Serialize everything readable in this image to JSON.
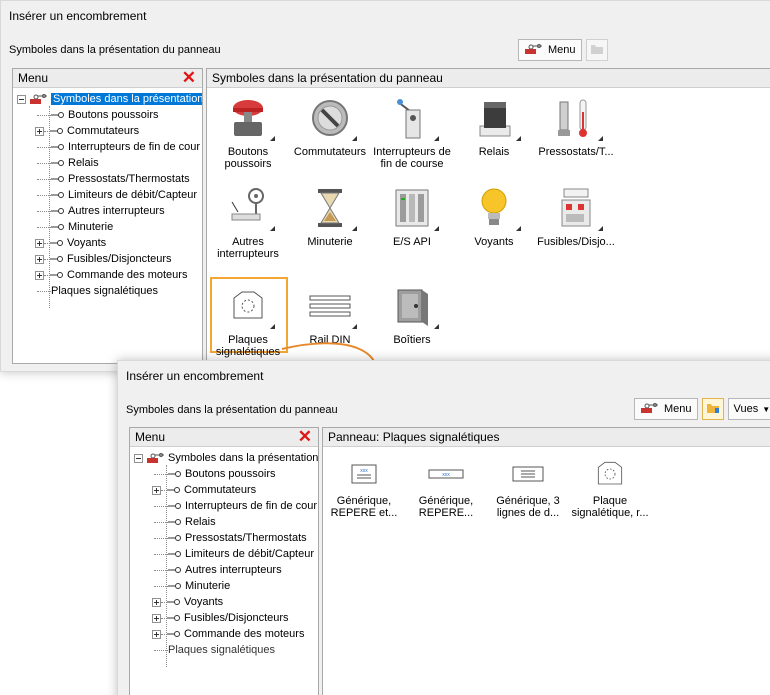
{
  "back_window": {
    "title": "Insérer un encombrement",
    "presentation_label": "Symboles dans la présentation du panneau",
    "menu_button": "Menu",
    "tree_header": "Menu",
    "panel_header": "Symboles dans la présentation du panneau",
    "tree": {
      "root": "Symboles dans la présentation",
      "items": [
        {
          "label": "Boutons poussoirs"
        },
        {
          "label": "Commutateurs"
        },
        {
          "label": "Interrupteurs de fin de cour"
        },
        {
          "label": "Relais"
        },
        {
          "label": "Pressostats/Thermostats"
        },
        {
          "label": "Limiteurs de débit/Capteur"
        },
        {
          "label": "Autres interrupteurs"
        },
        {
          "label": "Minuterie"
        },
        {
          "label": "Voyants"
        },
        {
          "label": "Fusibles/Disjoncteurs"
        },
        {
          "label": "Commande des moteurs"
        },
        {
          "label": "Plaques signalétiques"
        }
      ]
    },
    "tiles": [
      {
        "label": "Boutons poussoirs"
      },
      {
        "label": "Commutateurs"
      },
      {
        "label": "Interrupteurs de fin de course"
      },
      {
        "label": "Relais"
      },
      {
        "label": "Pressostats/T..."
      },
      {
        "label": "Autres interrupteurs"
      },
      {
        "label": "Minuterie"
      },
      {
        "label": "E/S API"
      },
      {
        "label": "Voyants"
      },
      {
        "label": "Fusibles/Disjo..."
      },
      {
        "label": "Plaques signalétiques"
      },
      {
        "label": "Rail DIN"
      },
      {
        "label": "Boîtiers"
      }
    ]
  },
  "front_window": {
    "title": "Insérer un encombrement",
    "presentation_label": "Symboles dans la présentation du panneau",
    "menu_button": "Menu",
    "views_button": "Vues",
    "tree_header": "Menu",
    "panel_header": "Panneau: Plaques signalétiques",
    "tree": {
      "root": "Symboles dans la présentation",
      "items": [
        {
          "label": "Boutons poussoirs"
        },
        {
          "label": "Commutateurs"
        },
        {
          "label": "Interrupteurs de fin de cour"
        },
        {
          "label": "Relais"
        },
        {
          "label": "Pressostats/Thermostats"
        },
        {
          "label": "Limiteurs de débit/Capteur"
        },
        {
          "label": "Autres interrupteurs"
        },
        {
          "label": "Minuterie"
        },
        {
          "label": "Voyants"
        },
        {
          "label": "Fusibles/Disjoncteurs"
        },
        {
          "label": "Commande des moteurs"
        },
        {
          "label": "Plaques signalétiques"
        }
      ]
    },
    "tiles": [
      {
        "label": "Générique, REPERE et..."
      },
      {
        "label": "Générique, REPERE..."
      },
      {
        "label": "Générique, 3 lignes de d..."
      },
      {
        "label": "Plaque signalétique, r..."
      }
    ]
  },
  "colors": {
    "selection": "#0078d7",
    "highlight_border": "#f4a633",
    "close_x": "#e01515",
    "arrow": "#e8892b"
  }
}
